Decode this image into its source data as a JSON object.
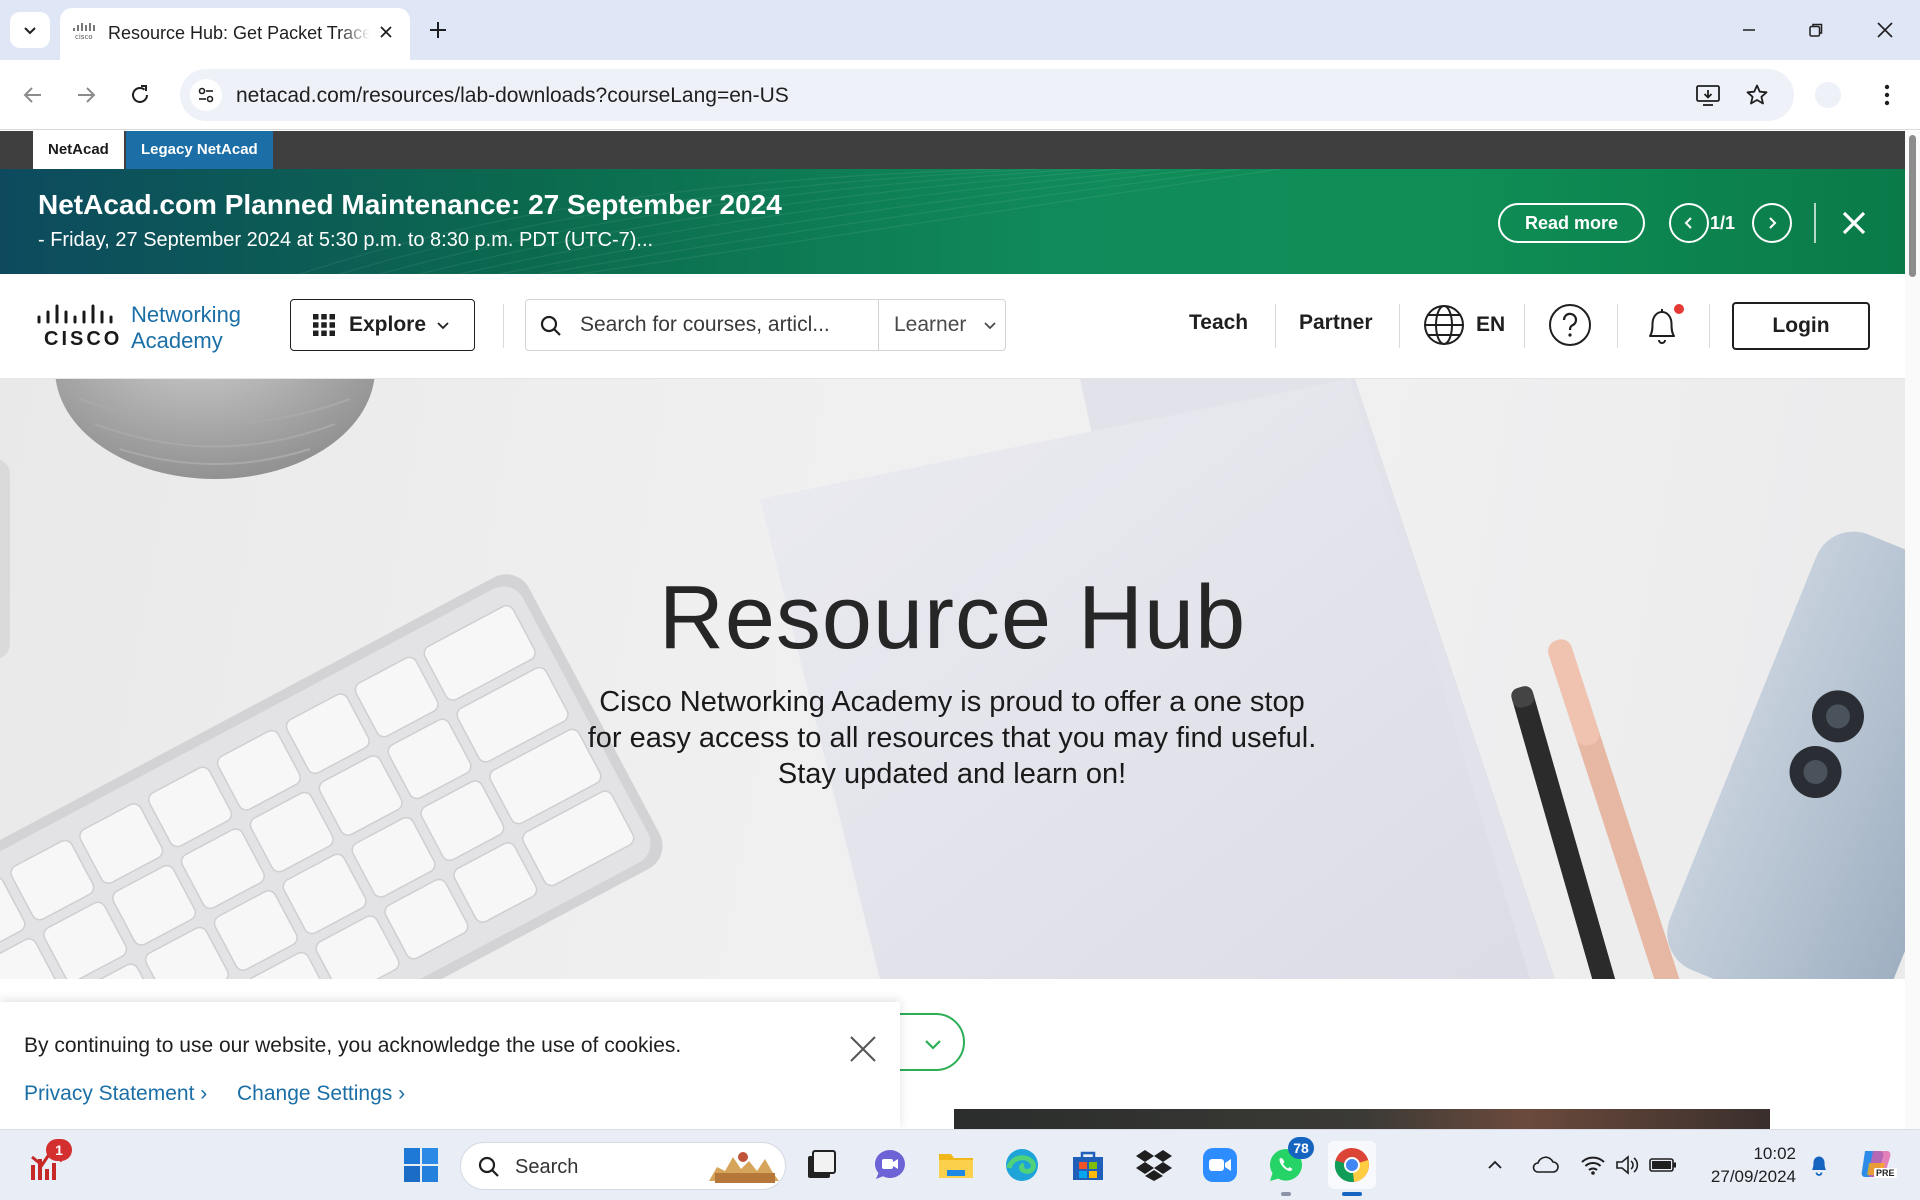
{
  "browser": {
    "tab_title": "Resource Hub: Get Packet Tracer",
    "url": "netacad.com/resources/lab-downloads?courseLang=en-US"
  },
  "switcher": {
    "netacad": "NetAcad",
    "legacy": "Legacy NetAcad"
  },
  "banner": {
    "title": "NetAcad.com Planned Maintenance: 27 September 2024",
    "subtitle": "- Friday, 27 September 2024 at 5:30 p.m. to 8:30 p.m. PDT (UTC-7)...",
    "read_more": "Read more",
    "pager": "1/1"
  },
  "header": {
    "logo_word": "CISCO",
    "logo_line1": "Networking",
    "logo_line2": "Academy",
    "explore": "Explore",
    "search_placeholder": "Search for courses, articl...",
    "role": "Learner",
    "teach": "Teach",
    "partner": "Partner",
    "language": "EN",
    "login": "Login"
  },
  "hero": {
    "title": "Resource Hub",
    "text": "Cisco Networking Academy is proud to offer a one stop for easy access to all resources that you may find useful. Stay updated and learn on!"
  },
  "cookie": {
    "text": "By continuing to use our website, you acknowledge the use of cookies.",
    "privacy": "Privacy Statement ›",
    "settings": "Change Settings ›"
  },
  "taskbar": {
    "search_label": "Search",
    "whatsapp_badge": "78",
    "app_badge": "1",
    "time": "10:02",
    "date": "27/09/2024",
    "copilot_label": "PRE"
  },
  "colors": {
    "cisco_blue": "#1b6fa6",
    "banner_green": "#108a5a",
    "accent_green": "#2cae55"
  }
}
